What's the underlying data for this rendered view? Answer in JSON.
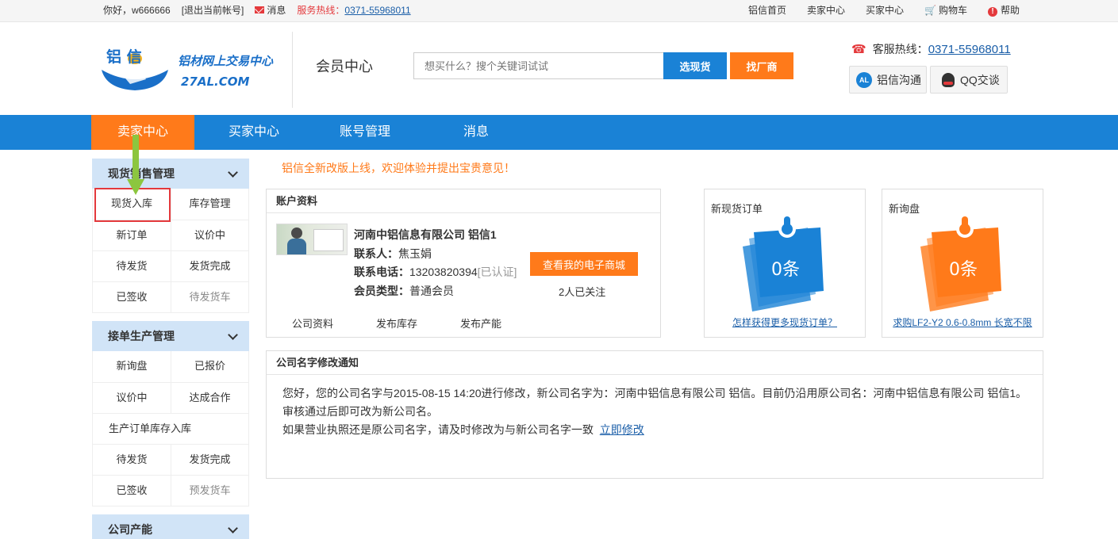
{
  "topbar": {
    "greeting": "你好，w666666",
    "logout": "[退出当前帐号]",
    "messages": "消息",
    "hotline_label": "服务热线：",
    "hotline_number": "0371-55968011",
    "links": {
      "home": "铝信首页",
      "seller": "卖家中心",
      "buyer": "买家中心",
      "cart": "购物车",
      "help": "帮助"
    }
  },
  "header": {
    "logo_chars": "铝 信",
    "logo_slogan": "铝材网上交易中心",
    "logo_domain": "27AL.COM",
    "page_title": "会员中心",
    "search_placeholder": "想买什么？搜个关键词试试",
    "search_button": "选现货",
    "factory_button": "找厂商",
    "service_label": "客服热线：",
    "service_number": "0371-55968011",
    "chat_al": "铝信沟通",
    "chat_al_badge": "AL",
    "chat_qq": "QQ交谈"
  },
  "nav": {
    "seller": "卖家中心",
    "buyer": "买家中心",
    "account": "账号管理",
    "messages": "消息"
  },
  "sidebar": {
    "spot": {
      "title": "现货销售管理",
      "rows": [
        [
          "现货入库",
          "库存管理"
        ],
        [
          "新订单",
          "议价中"
        ],
        [
          "待发货",
          "发货完成"
        ],
        [
          "已签收",
          "待发货车"
        ]
      ]
    },
    "production": {
      "title": "接单生产管理",
      "rows": [
        [
          "新询盘",
          "已报价"
        ],
        [
          "议价中",
          "达成合作"
        ]
      ],
      "full_row": "生产订单库存入库",
      "rows2": [
        [
          "待发货",
          "发货完成"
        ],
        [
          "已签收",
          "预发货车"
        ]
      ]
    },
    "capacity": {
      "title": "公司产能"
    }
  },
  "main": {
    "notice": "铝信全新改版上线，欢迎体验并提出宝贵意见！",
    "account": {
      "title": "账户资料",
      "company": "河南中铝信息有限公司 铝信1",
      "contact_label": "联系人：",
      "contact": "焦玉娟",
      "phone_label": "联系电话：",
      "phone": "13203820394",
      "phone_status": "[已认证]",
      "type_label": "会员类型：",
      "type": "普通会员",
      "shop_button": "查看我的电子商城",
      "followers": "2人已关注",
      "links": [
        "公司资料",
        "发布库存",
        "发布产能"
      ]
    },
    "new_orders": {
      "title": "新现货订单",
      "count": "0条",
      "link": "怎样获得更多现货订单？",
      "color": "#1a82d6"
    },
    "new_inquiry": {
      "title": "新询盘",
      "count": "0条",
      "link": "求购LF2-Y2 0.6-0.8mm 长宽不限",
      "color": "#ff7a1a"
    },
    "rename": {
      "title": "公司名字修改通知",
      "line1": "您好，您的公司名字与2015-08-15 14:20进行修改，新公司名字为：河南中铝信息有限公司 铝信。目前仍沿用原公司名：河南中铝信息有限公司 铝信1。",
      "line2": "审核通过后即可改为新公司名。",
      "line3": "如果营业执照还是原公司名字，请及时修改为与新公司名字一致",
      "action": "立即修改"
    }
  }
}
